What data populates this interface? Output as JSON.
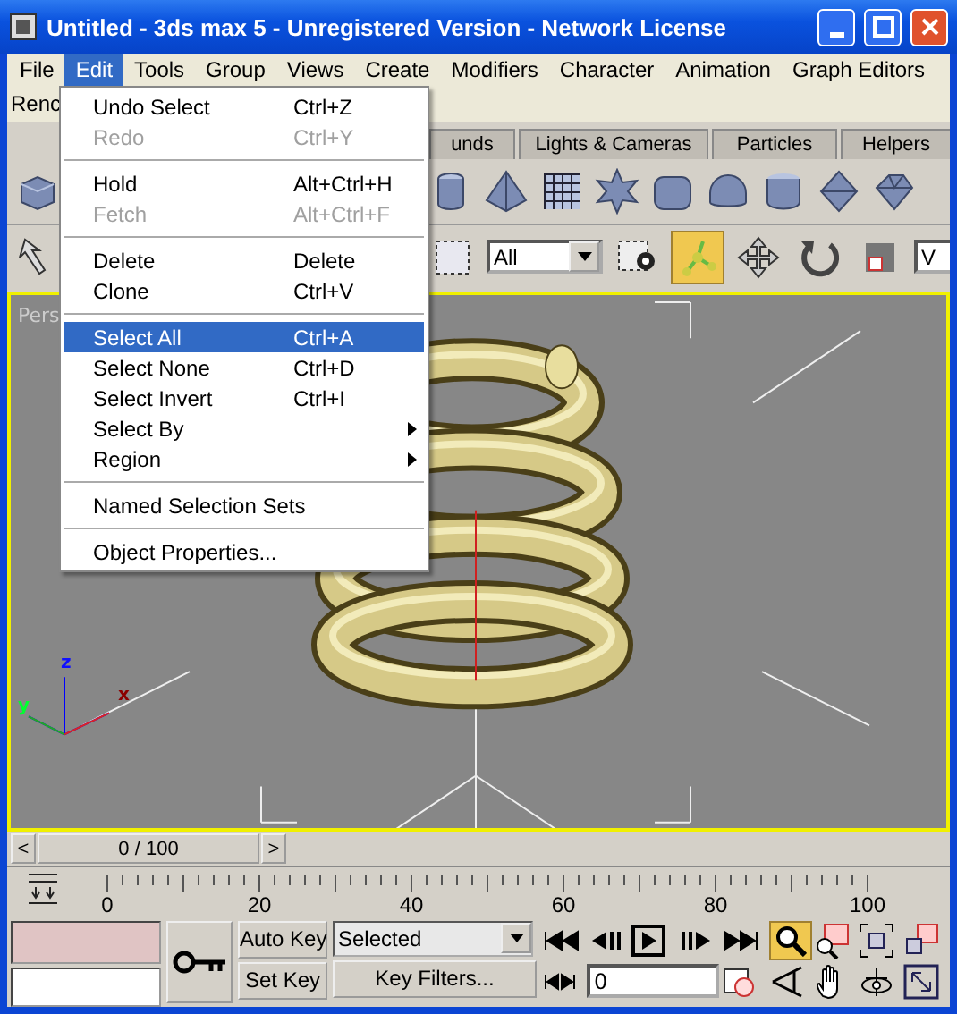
{
  "window": {
    "title": "Untitled - 3ds max 5 - Unregistered Version - Network License"
  },
  "menu_bar": {
    "items": [
      {
        "label": "File",
        "selected": false
      },
      {
        "label": "Edit",
        "selected": true
      },
      {
        "label": "Tools",
        "selected": false
      },
      {
        "label": "Group",
        "selected": false
      },
      {
        "label": "Views",
        "selected": false
      },
      {
        "label": "Create",
        "selected": false
      },
      {
        "label": "Modifiers",
        "selected": false
      },
      {
        "label": "Character",
        "selected": false
      },
      {
        "label": "Animation",
        "selected": false
      },
      {
        "label": "Graph Editors",
        "selected": false
      }
    ],
    "second_row": [
      "Renc"
    ]
  },
  "edit_menu": {
    "items": [
      {
        "kind": "item",
        "label": "Undo Select",
        "shortcut": "Ctrl+Z",
        "disabled": false,
        "selected": false
      },
      {
        "kind": "item",
        "label": "Redo",
        "shortcut": "Ctrl+Y",
        "disabled": true,
        "selected": false
      },
      {
        "kind": "separator"
      },
      {
        "kind": "item",
        "label": "Hold",
        "shortcut": "Alt+Ctrl+H",
        "disabled": false,
        "selected": false
      },
      {
        "kind": "item",
        "label": "Fetch",
        "shortcut": "Alt+Ctrl+F",
        "disabled": true,
        "selected": false
      },
      {
        "kind": "separator"
      },
      {
        "kind": "item",
        "label": "Delete",
        "shortcut": "Delete",
        "disabled": false,
        "selected": false
      },
      {
        "kind": "item",
        "label": "Clone",
        "shortcut": "Ctrl+V",
        "disabled": false,
        "selected": false
      },
      {
        "kind": "separator"
      },
      {
        "kind": "item",
        "label": "Select All",
        "shortcut": "Ctrl+A",
        "disabled": false,
        "selected": true
      },
      {
        "kind": "item",
        "label": "Select None",
        "shortcut": "Ctrl+D",
        "disabled": false,
        "selected": false
      },
      {
        "kind": "item",
        "label": "Select Invert",
        "shortcut": "Ctrl+I",
        "disabled": false,
        "selected": false
      },
      {
        "kind": "submenu",
        "label": "Select By",
        "disabled": false,
        "selected": false
      },
      {
        "kind": "submenu",
        "label": "Region",
        "disabled": false,
        "selected": false
      },
      {
        "kind": "separator"
      },
      {
        "kind": "item",
        "label": "Named Selection Sets",
        "disabled": false,
        "selected": false
      },
      {
        "kind": "separator"
      },
      {
        "kind": "item",
        "label": "Object Properties...",
        "disabled": false,
        "selected": false
      }
    ]
  },
  "tabs": [
    {
      "label": "unds",
      "selected": false
    },
    {
      "label": "Lights & Cameras",
      "selected": false
    },
    {
      "label": "Particles",
      "selected": false
    },
    {
      "label": "Helpers",
      "selected": false
    }
  ],
  "main_toolbar": {
    "selection_filter": "All",
    "cut_dropdown": "V"
  },
  "viewport": {
    "label": "Pers",
    "axis_labels": [
      "z",
      "y",
      "x"
    ]
  },
  "time_slider": {
    "label": "0 / 100",
    "prev": "<",
    "next": ">",
    "level": 0
  },
  "track_bar": {
    "labels": [
      "0",
      "20",
      "40",
      "60",
      "80",
      "100"
    ]
  },
  "animation_controls": {
    "auto_key": "Auto Key",
    "auto_key_on": false,
    "key_mode": "Selected",
    "set_key": "Set Key",
    "key_filters": "Key Filters...",
    "frame": "0"
  }
}
